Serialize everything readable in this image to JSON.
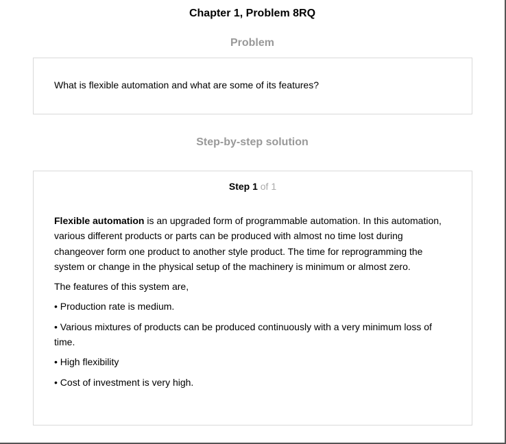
{
  "header": {
    "chapter_title": "Chapter 1, Problem 8RQ"
  },
  "problem": {
    "heading": "Problem",
    "question": "What is flexible automation and what are some of its features?"
  },
  "solution": {
    "heading": "Step-by-step solution",
    "step": {
      "label": "Step 1",
      "of": "of 1"
    },
    "intro_term": "Flexible automation",
    "intro_rest": " is an upgraded form of programmable automation. In this automation, various different products or parts can be produced with almost no time lost during changeover form one product to another style product. The time for reprogramming the system or change in the physical setup of the machinery is minimum or almost zero.",
    "features_lead": "The features of this system are,",
    "features": [
      "• Production rate is medium.",
      "• Various mixtures of products can be produced continuously with a very minimum loss of time.",
      "• High flexibility",
      "• Cost of investment is very high."
    ]
  },
  "colors": {
    "heading_gray": "#999999",
    "card_border": "#d9d9d9",
    "step_of_gray": "#aaaaaa"
  }
}
